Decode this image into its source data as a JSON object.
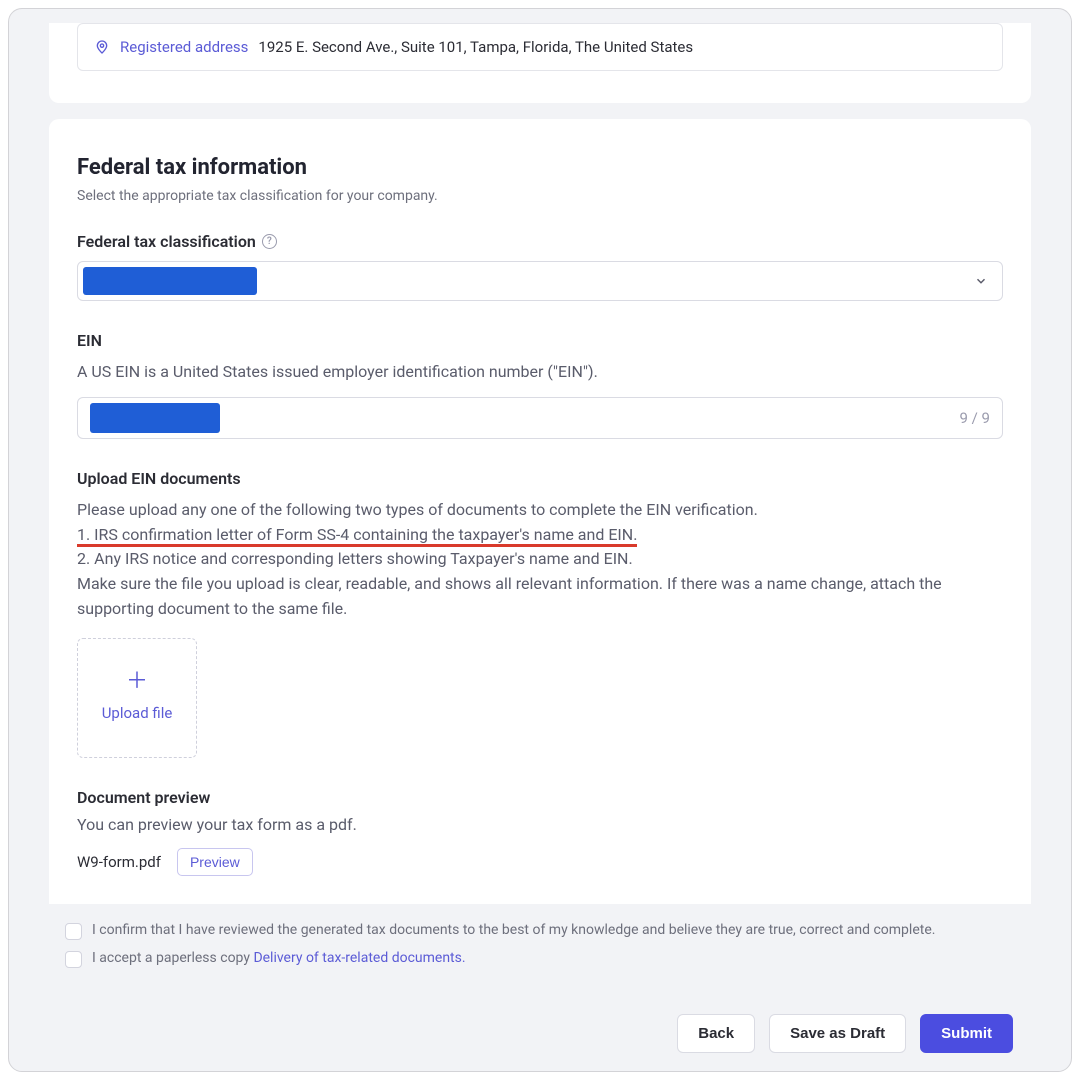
{
  "address": {
    "label": "Registered address",
    "value": "1925 E. Second Ave., Suite 101, Tampa, Florida, The United States"
  },
  "section": {
    "title": "Federal tax information",
    "subtitle": "Select the appropriate tax classification for your company."
  },
  "classification": {
    "label": "Federal tax classification"
  },
  "ein": {
    "label": "EIN",
    "help": "A US EIN is a United States issued employer identification number (\"EIN\").",
    "count": "9 / 9"
  },
  "upload": {
    "label": "Upload EIN documents",
    "intro": "Please upload any one of the following two types of documents to complete the EIN verification.",
    "line1": "1. IRS confirmation letter of Form SS-4 containing the taxpayer's name and EIN.",
    "line2": "2. Any IRS notice and corresponding letters showing Taxpayer's name and EIN.",
    "note": "Make sure the file you upload is clear, readable, and shows all relevant information. If there was a name change, attach the supporting document to the same file.",
    "button": "Upload file"
  },
  "preview": {
    "label": "Document preview",
    "help": "You can preview your tax form as a pdf.",
    "filename": "W9-form.pdf",
    "button": "Preview"
  },
  "checks": {
    "confirm": "I confirm that I have reviewed the generated tax documents to the best of my knowledge and believe they are true, correct and complete.",
    "paperless_prefix": "I accept a paperless copy ",
    "paperless_link": "Delivery of tax-related documents."
  },
  "footer": {
    "back": "Back",
    "draft": "Save as Draft",
    "submit": "Submit"
  }
}
